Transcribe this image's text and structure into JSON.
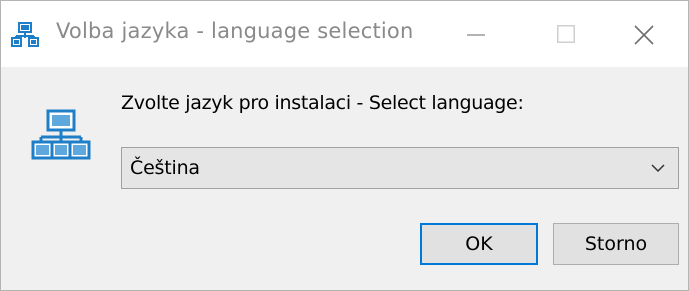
{
  "window": {
    "title": "Volba jazyka - language selection",
    "icon": "installer-network-icon",
    "controls": {
      "minimize": "minimize-icon",
      "maximize": "maximize-icon",
      "close": "close-icon"
    }
  },
  "dialog": {
    "prompt": "Zvolte jazyk pro instalaci - Select language:",
    "language_select": {
      "value": "Čeština",
      "icon": "chevron-down-icon"
    },
    "buttons": {
      "ok": "OK",
      "cancel": "Storno"
    }
  },
  "colors": {
    "accent": "#0078d7",
    "icon_blue": "#1e7fc8",
    "title_text": "#8a8a8a",
    "dialog_bg": "#f0f0f0"
  }
}
